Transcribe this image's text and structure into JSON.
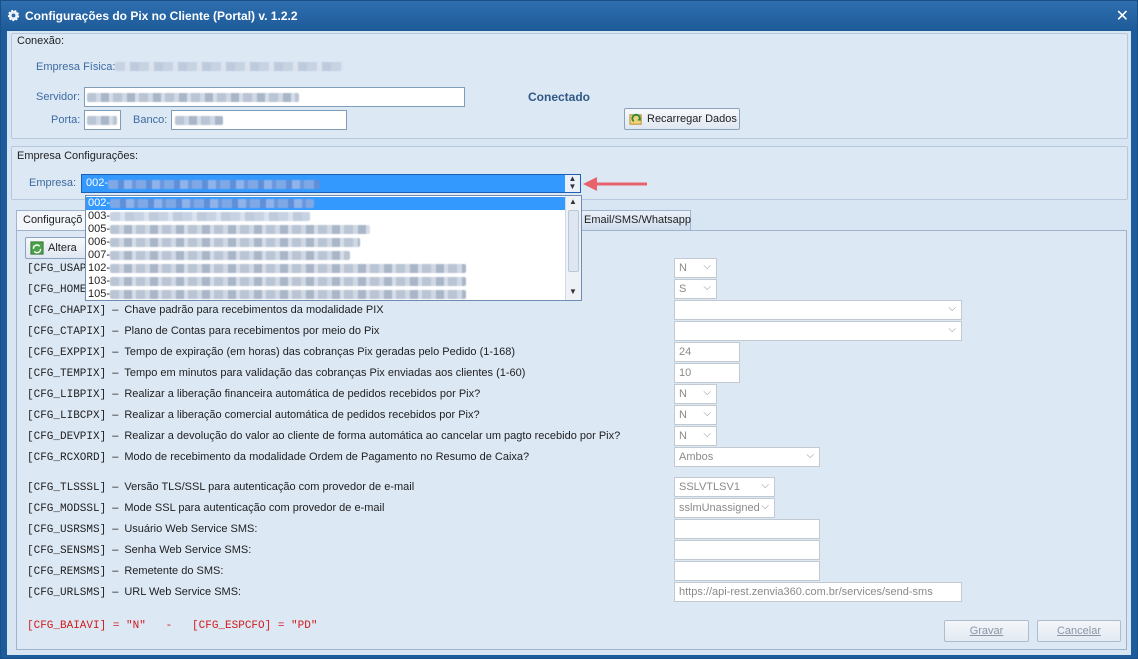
{
  "window": {
    "title": "Configurações do Pix no Cliente (Portal) v. 1.2.2"
  },
  "connection": {
    "group_title": "Conexão:",
    "empresa_fisica_label": "Empresa Física:",
    "servidor_label": "Servidor:",
    "porta_label": "Porta:",
    "banco_label": "Banco:",
    "status": "Conectado",
    "reload_button": "Recarregar Dados"
  },
  "company": {
    "group_title": "Empresa Configurações:",
    "empresa_label": "Empresa:",
    "selected_prefix": "002-",
    "dropdown_items": [
      "002-",
      "003-",
      "005-",
      "006-",
      "007-",
      "102-",
      "103-",
      "105-"
    ]
  },
  "tabs": [
    {
      "label": "Configuraçõ"
    },
    {
      "label": "Email/SMS/Whatsapp"
    }
  ],
  "toolbar": {
    "alter_label": "Altera"
  },
  "rows": [
    {
      "code": "[CFG_USAP",
      "desc": "",
      "value": "N"
    },
    {
      "code": "[CFG_HOME",
      "desc": "",
      "value": "S"
    },
    {
      "code": "[CFG_CHAPIX]",
      "desc": "Chave padrão para recebimentos da modalidade PIX",
      "value": ""
    },
    {
      "code": "[CFG_CTAPIX]",
      "desc": "Plano de Contas para recebimentos por meio do Pix",
      "value": ""
    },
    {
      "code": "[CFG_EXPPIX]",
      "desc": "Tempo de expiração (em horas) das cobranças Pix geradas pelo Pedido (1-168)",
      "value": "24"
    },
    {
      "code": "[CFG_TEMPIX]",
      "desc": "Tempo em minutos para validação das cobranças Pix enviadas aos clientes (1-60)",
      "value": "10"
    },
    {
      "code": "[CFG_LIBPIX]",
      "desc": "Realizar a liberação financeira automática de pedidos recebidos por Pix?",
      "value": "N"
    },
    {
      "code": "[CFG_LIBCPX]",
      "desc": "Realizar a liberação comercial automática de pedidos recebidos por Pix?",
      "value": "N"
    },
    {
      "code": "[CFG_DEVPIX]",
      "desc": "Realizar a devolução do valor ao cliente de forma automática ao cancelar um pagto recebido por Pix?",
      "value": "N"
    },
    {
      "code": "[CFG_RCXORD]",
      "desc": "Modo de recebimento da modalidade Ordem de Pagamento no Resumo de Caixa?",
      "value": "Ambos"
    },
    {
      "code": "[CFG_TLSSSL]",
      "desc": "Versão TLS/SSL para autenticação com provedor de e-mail",
      "value": "SSLVTLSV1"
    },
    {
      "code": "[CFG_MODSSL]",
      "desc": "Mode SSL para autenticação com provedor de e-mail",
      "value": "sslmUnassigned"
    },
    {
      "code": "[CFG_USRSMS]",
      "desc": "Usuário Web Service SMS:",
      "value": ""
    },
    {
      "code": "[CFG_SENSMS]",
      "desc": "Senha Web Service SMS:",
      "value": ""
    },
    {
      "code": "[CFG_REMSMS]",
      "desc": "Remetente do SMS:",
      "value": ""
    },
    {
      "code": "[CFG_URLSMS]",
      "desc": "URL Web Service SMS:",
      "value": "https://api-rest.zenvia360.com.br/services/send-sms"
    }
  ],
  "footer": {
    "red_info": "[CFG_BAIAVI] = \"N\"   -   [CFG_ESPCFO] = \"PD\"",
    "save_button": "Gravar",
    "cancel_button": "Cancelar"
  },
  "colors": {
    "title_bar": "#1d5a98",
    "selection": "#3399ff",
    "arrow": "#e8636c",
    "red_text": "#d11b1b"
  }
}
